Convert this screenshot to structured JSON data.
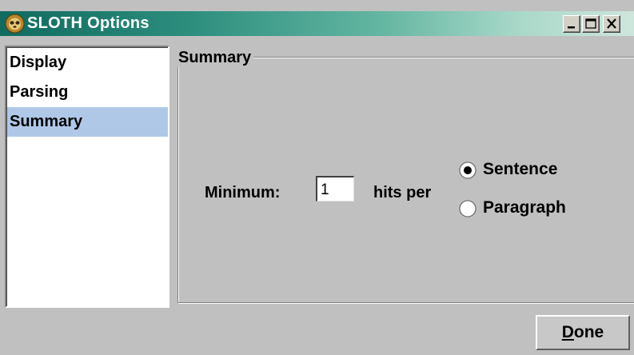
{
  "window": {
    "title": "SLOTH Options",
    "icon": "sloth-app-icon",
    "controls": [
      "minimize-icon",
      "maximize-icon",
      "close-icon"
    ]
  },
  "sidebar": {
    "items": [
      {
        "label": "Display",
        "selected": false
      },
      {
        "label": "Parsing",
        "selected": false
      },
      {
        "label": "Summary",
        "selected": true
      }
    ],
    "selected_color": "#b0c8e8"
  },
  "panel": {
    "group_title": "Summary",
    "minimum_label": "Minimum:",
    "minimum_value": "1",
    "hits_label": "hits per",
    "radio_options": [
      {
        "label": "Sentence",
        "checked": true
      },
      {
        "label": "Paragraph",
        "checked": false
      }
    ]
  },
  "footer": {
    "done_mnemonic": "D",
    "done_rest": "one"
  }
}
